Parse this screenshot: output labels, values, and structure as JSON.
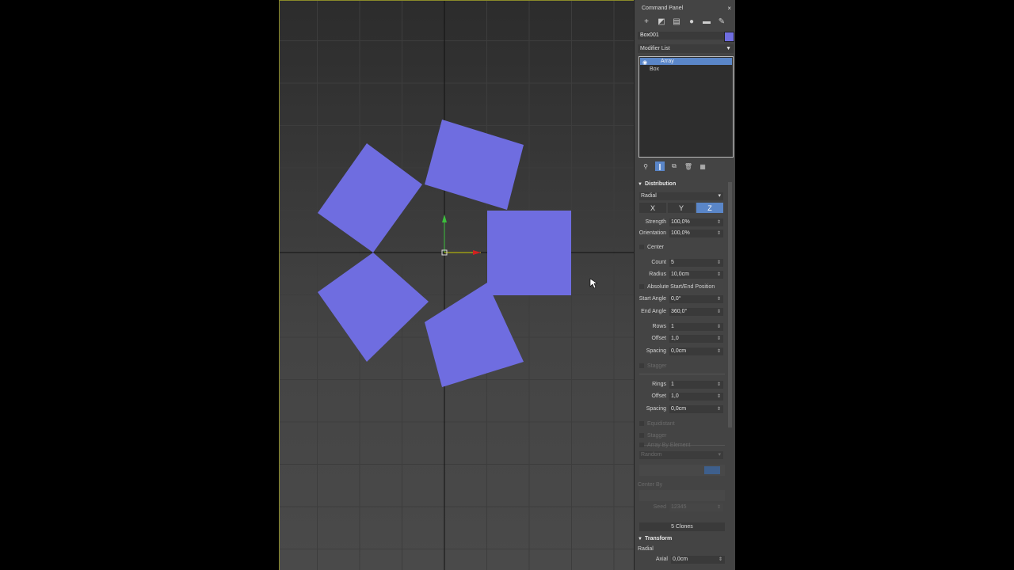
{
  "panel": {
    "title": "Command Panel",
    "close_glyph": "×",
    "tab_icons": [
      "create-icon",
      "modify-icon",
      "hierarchy-icon",
      "motion-icon",
      "display-icon",
      "utilities-icon"
    ],
    "object_name": "Box001",
    "object_color": "#6f6de0",
    "modifier_list_label": "Modifier List",
    "stack": [
      "Array",
      "Box"
    ],
    "accent": "#5a86c8"
  },
  "distribution": {
    "heading": "Distribution",
    "mode": "Radial",
    "axes": [
      "X",
      "Y",
      "Z"
    ],
    "active_axis": "Z",
    "strength_label": "Strength",
    "strength": "100,0%",
    "orientation_label": "Orientation",
    "orientation": "100,0%",
    "center_label": "Center",
    "count_label": "Count",
    "count": "5",
    "radius_label": "Radius",
    "radius": "10,0cm",
    "abs_label": "Absolute Start/End Position",
    "start_angle_label": "Start Angle",
    "start_angle": "0,0°",
    "end_angle_label": "End Angle",
    "end_angle": "360,0°",
    "rows_label": "Rows",
    "rows": "1",
    "offset_label": "Offset",
    "offset": "1,0",
    "spacing_label": "Spacing",
    "spacing": "0,0cm",
    "stagger_label": "Stagger",
    "rings_label": "Rings",
    "rings": "1",
    "rings_offset": "1,0",
    "rings_spacing": "0,0cm",
    "equidistant_label": "Equidistant",
    "stagger2_label": "Stagger",
    "array_by_element_label": "Array By Element",
    "random_label": "Random",
    "center_by_label": "Center By",
    "seed_label": "Seed",
    "seed": "12345",
    "clones_label": "5 Clones"
  },
  "transform": {
    "heading": "Transform",
    "mode": "Radial",
    "axial_label": "Axial",
    "axial": "0,0cm"
  },
  "viewport": {
    "shape_color": "#6f6de0"
  }
}
